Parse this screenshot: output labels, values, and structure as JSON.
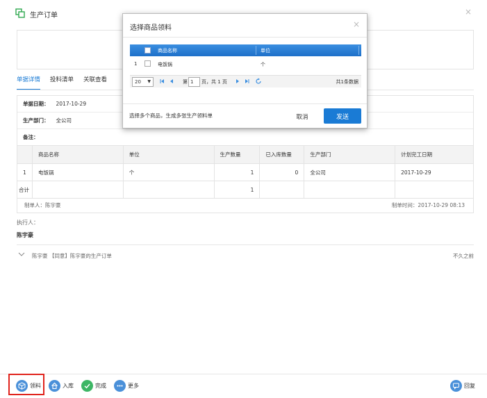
{
  "page": {
    "title": "生产订单",
    "close_glyph": "×"
  },
  "tabs": [
    {
      "label": "单据详情",
      "active": true
    },
    {
      "label": "投料清单",
      "active": false
    },
    {
      "label": "关联查看",
      "active": false
    }
  ],
  "info": {
    "date_label": "单据日期：",
    "date_value": "2017-10-29",
    "dept_label": "生产部门：",
    "dept_value": "全公司",
    "note_label": "备注："
  },
  "detail_table": {
    "headers": [
      "",
      "商品名称",
      "单位",
      "生产数量",
      "已入库数量",
      "生产部门",
      "计划完工日期"
    ],
    "rows": [
      [
        "1",
        "电饭锅",
        "个",
        "1",
        "0",
        "全公司",
        "2017-10-29"
      ]
    ],
    "total_row": [
      "合计",
      "",
      "",
      "1",
      "",
      "",
      ""
    ]
  },
  "footer": {
    "creator": "制单人：陈宇豪",
    "created_time": "制单时间：2017-10-29 08:13"
  },
  "executor": {
    "label": "执行人：",
    "name": "陈宇豪"
  },
  "activity": {
    "text": "陈宇豪 【同意】陈宇豪的生产订单",
    "time": "不久之前"
  },
  "bottom_bar": {
    "pick_label": "领料",
    "stockin_label": "入库",
    "complete_label": "完成",
    "more_label": "更多",
    "reply_label": "回复"
  },
  "modal": {
    "title": "选择商品领料",
    "close_glyph": "×",
    "col_name": "商品名称",
    "col_unit": "单位",
    "rows": [
      {
        "index": "1",
        "name": "电饭锅",
        "unit": "个"
      }
    ],
    "page_size": "20",
    "page_prefix": "第",
    "page_value": "1",
    "page_suffix": "页，共 1 页",
    "total_text": "共1条数据",
    "hint": "选择多个商品，生成多张生产领料单",
    "cancel_label": "取消",
    "send_label": "发送"
  },
  "colors": {
    "accent": "#1a7bd5",
    "highlight": "#e0231c",
    "complete_green": "#3db665"
  }
}
